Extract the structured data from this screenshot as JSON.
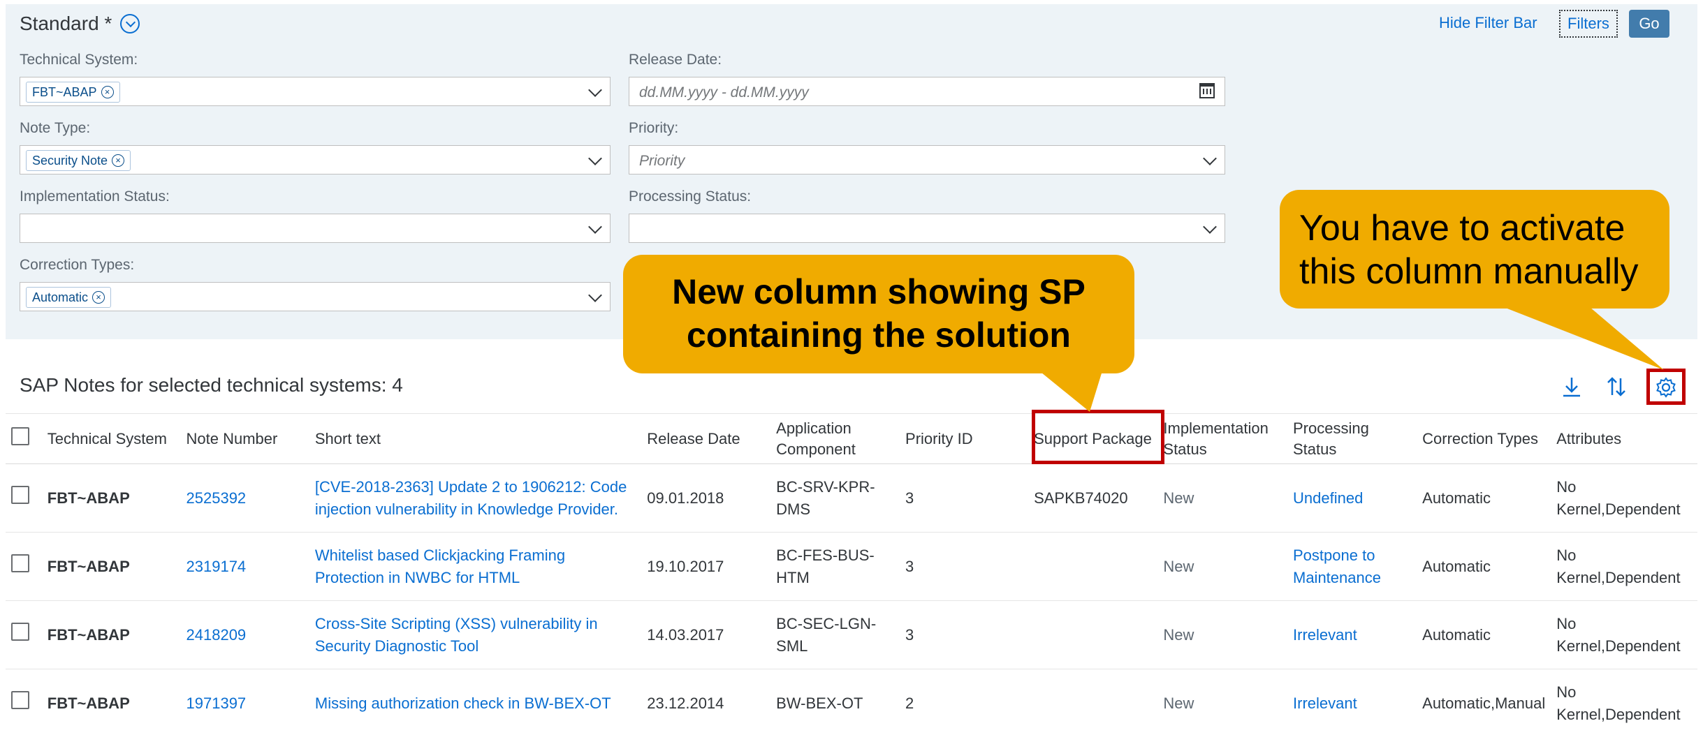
{
  "filterbar": {
    "variant_title": "Standard *",
    "hide_filter_bar": "Hide Filter Bar",
    "filters": "Filters",
    "go": "Go",
    "fields": {
      "technical_system": {
        "label": "Technical System:",
        "token": "FBT~ABAP"
      },
      "release_date": {
        "label": "Release Date:",
        "placeholder": "dd.MM.yyyy - dd.MM.yyyy"
      },
      "note_type": {
        "label": "Note Type:",
        "token": "Security Note"
      },
      "priority": {
        "label": "Priority:",
        "placeholder": "Priority"
      },
      "implementation_status": {
        "label": "Implementation Status:"
      },
      "processing_status": {
        "label": "Processing Status:"
      },
      "correction_types": {
        "label": "Correction Types:",
        "token": "Automatic"
      }
    }
  },
  "table": {
    "title": "SAP Notes for selected technical systems: 4",
    "toolbar_icons": [
      "download-icon",
      "sort-icon",
      "settings-icon"
    ],
    "headers": {
      "technical_system": "Technical System",
      "note_number": "Note Number",
      "short_text": "Short text",
      "release_date": "Release Date",
      "application_component": "Application Component",
      "priority_id": "Priority ID",
      "support_package": "Support Package",
      "implementation_status": "Implementation Status",
      "processing_status": "Processing Status",
      "correction_types": "Correction Types",
      "attributes": "Attributes"
    },
    "rows": [
      {
        "system": "FBT~ABAP",
        "note": "2525392",
        "text": "[CVE-2018-2363] Update 2 to 1906212: Code injection vulnerability in Knowledge Provider.",
        "date": "09.01.2018",
        "component": "BC-SRV-KPR-DMS",
        "priority": "3",
        "sp": "SAPKB74020",
        "impl": "New",
        "proc": "Undefined",
        "corr": "Automatic",
        "attr": "No Kernel,Dependent"
      },
      {
        "system": "FBT~ABAP",
        "note": "2319174",
        "text": "Whitelist based Clickjacking Framing Protection in NWBC for HTML",
        "date": "19.10.2017",
        "component": "BC-FES-BUS-HTM",
        "priority": "3",
        "sp": "",
        "impl": "New",
        "proc": "Postpone to Maintenance",
        "corr": "Automatic",
        "attr": "No Kernel,Dependent"
      },
      {
        "system": "FBT~ABAP",
        "note": "2418209",
        "text": "Cross-Site Scripting (XSS) vulnerability in Security Diagnostic Tool",
        "date": "14.03.2017",
        "component": "BC-SEC-LGN-SML",
        "priority": "3",
        "sp": "",
        "impl": "New",
        "proc": "Irrelevant",
        "corr": "Automatic",
        "attr": "No Kernel,Dependent"
      },
      {
        "system": "FBT~ABAP",
        "note": "1971397",
        "text": "Missing authorization check in BW-BEX-OT",
        "date": "23.12.2014",
        "component": "BW-BEX-OT",
        "priority": "2",
        "sp": "",
        "impl": "New",
        "proc": "Irrelevant",
        "corr": "Automatic,Manual",
        "attr": "No Kernel,Dependent"
      }
    ]
  },
  "callouts": {
    "new_column": "New column showing SP containing the solution",
    "activate": "You have to activate this column manually"
  },
  "colors": {
    "accent": "#0a6ed1",
    "highlight": "#c00000",
    "callout": "#f0ab00",
    "filterbar_bg": "#edf3f7"
  }
}
